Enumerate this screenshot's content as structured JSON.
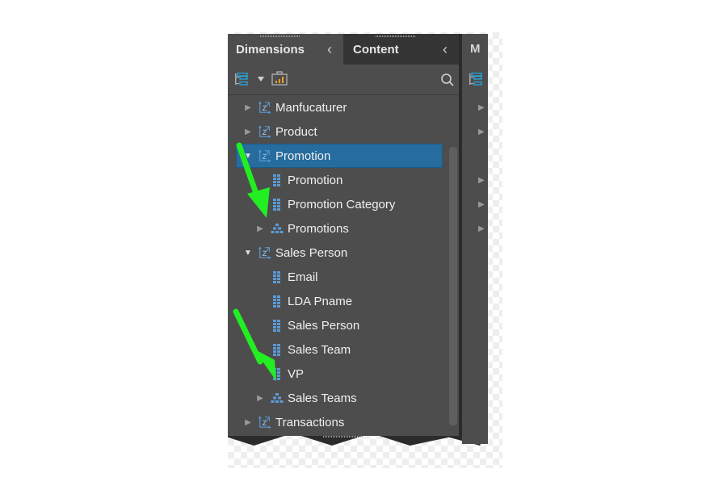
{
  "tabs": {
    "dimensions": {
      "label": "Dimensions"
    },
    "content": {
      "label": "Content"
    },
    "measures_partial": {
      "label": "M"
    }
  },
  "toolbar": {
    "icons": [
      "hierarchy-view-icon",
      "dropdown-caret-icon",
      "report-briefcase-icon",
      "search-icon"
    ]
  },
  "tree": [
    {
      "label": "Manfucaturer",
      "type": "dimension",
      "level": 0,
      "expanded": false
    },
    {
      "label": "Product",
      "type": "dimension",
      "level": 0,
      "expanded": false
    },
    {
      "label": "Promotion",
      "type": "dimension",
      "level": 0,
      "expanded": true,
      "selected": true
    },
    {
      "label": "Promotion",
      "type": "attribute",
      "level": 1
    },
    {
      "label": "Promotion Category",
      "type": "attribute",
      "level": 1
    },
    {
      "label": "Promotions",
      "type": "hierarchy",
      "level": 1,
      "expanded": false
    },
    {
      "label": "Sales Person",
      "type": "dimension",
      "level": 0,
      "expanded": true
    },
    {
      "label": "Email",
      "type": "attribute",
      "level": 1
    },
    {
      "label": "LDA Pname",
      "type": "attribute",
      "level": 1
    },
    {
      "label": "Sales Person",
      "type": "attribute",
      "level": 1
    },
    {
      "label": "Sales Team",
      "type": "attribute",
      "level": 1
    },
    {
      "label": "VP",
      "type": "attribute",
      "level": 1
    },
    {
      "label": "Sales Teams",
      "type": "hierarchy",
      "level": 1,
      "expanded": false
    },
    {
      "label": "Transactions",
      "type": "dimension",
      "level": 0,
      "expanded": false
    }
  ],
  "colors": {
    "panel_bg": "#4d4d4d",
    "selected_bg": "#266c9e",
    "icon_blue": "#5b9bd5",
    "accent_orange": "#f0a020",
    "annotation_green": "#22ee22"
  }
}
